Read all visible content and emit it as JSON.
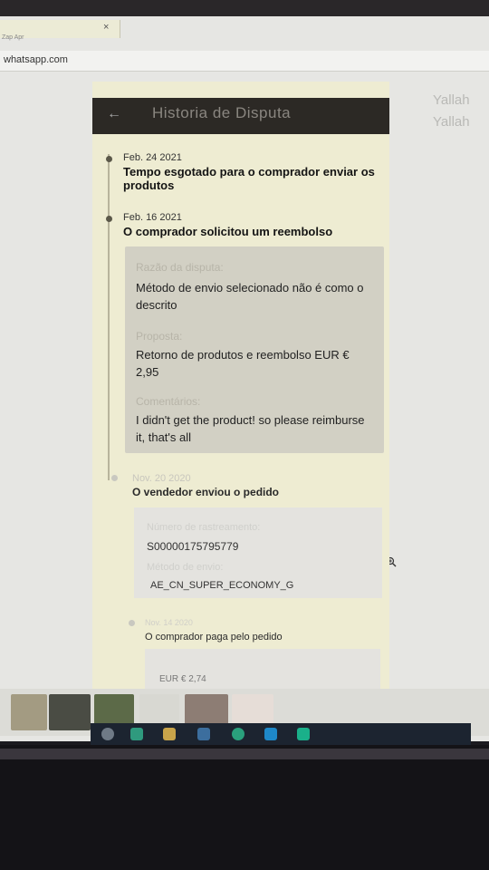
{
  "browser": {
    "tab_title": "Zap Apr",
    "tab_close": "×",
    "url": "whatsapp.com"
  },
  "background": {
    "side_text_1": "Yallah",
    "side_text_2": "Yallah"
  },
  "panel": {
    "back_icon": "←",
    "title": "Historia de Disputa"
  },
  "timeline": [
    {
      "date": "Feb. 24 2021",
      "event": "Tempo esgotado para o comprador enviar os produtos"
    },
    {
      "date": "Feb. 16 2021",
      "event": "O comprador solicitou um reembolso"
    },
    {
      "date": "Nov. 20 2020",
      "event": "O vendedor enviou o pedido"
    },
    {
      "date": "Nov. 14 2020",
      "event": "O comprador paga pelo pedido"
    }
  ],
  "refund_card": {
    "reason_label": "Razão da disputa:",
    "reason_value": "Método de envio selecionado não é como o descrito",
    "proposal_label": "Proposta:",
    "proposal_value": "Retorno de produtos e reembolso EUR € 2,95",
    "comments_label": "Comentários:",
    "comments_value": "I didn't get the product! so please reimburse it, that's all"
  },
  "shipping_card": {
    "tracking_label": "Número de rastreamento:",
    "tracking_value": "S00000175795779",
    "method_label": "Método de envio:",
    "method_value": "AE_CN_SUPER_ECONOMY_G"
  },
  "payment_card": {
    "amount_value": "EUR € 2,74"
  },
  "colors": {
    "panel_bg": "#eeecd2",
    "header_bg": "#2c2925",
    "card_bg": "#d2d0c4"
  }
}
